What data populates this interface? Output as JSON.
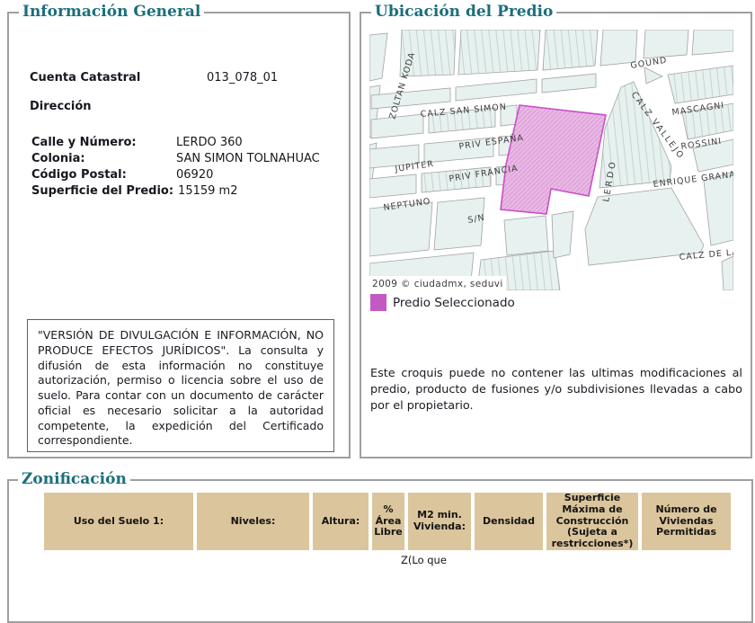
{
  "colors": {
    "teal": "#1b6e7d",
    "tan": "#dbc59c",
    "swatch": "#c35ac3",
    "parcel-fill": "#eab8e5",
    "parcel-stroke": "#c94fc9",
    "map-block": "#e7f1ef",
    "map-stroke": "#a3a3a3",
    "ink": "#17171f"
  },
  "sections": {
    "info_title": "Información General",
    "ubicacion_title": "Ubicación del Predio",
    "zonificacion_title": "Zonificación"
  },
  "info": {
    "cuenta_label": "Cuenta Catastral",
    "cuenta_value": "013_078_01",
    "direccion_label": "Dirección",
    "fields": [
      {
        "label": "Calle y Número:",
        "value": "LERDO 360"
      },
      {
        "label": "Colonia:",
        "value": "SAN SIMON TOLNAHUAC"
      },
      {
        "label": "Código Postal:",
        "value": "06920"
      },
      {
        "label": "Superficie del Predio:",
        "value": "15159 m2"
      }
    ],
    "disclaimer": "\"VERSIÓN DE DIVULGACIÓN E INFORMACIÓN, NO PRODUCE EFECTOS JURÍDICOS\". La consulta y difusión de esta información no constituye autorización, permiso o licencia sobre el uso de suelo. Para contar con un documento de carácter oficial es necesario solicitar a la autoridad competente, la expedición del Certificado correspondiente."
  },
  "ubicacion": {
    "map": {
      "attribution": "2009 © ciudadmx, seduvi",
      "labels": [
        "ZOLTAN KODA",
        "CALZ SAN SIMON",
        "PRIV ESPAÑA",
        "JUPITER",
        "PRIV FRANCIA",
        "NEPTUNO",
        "S/N",
        "LERDO",
        "CALZ VALLEJO",
        "GOUND",
        "MASCAGNI",
        "ROSSINI",
        "ENRIQUE GRANA",
        "CALZ DE LA"
      ]
    },
    "legend_label": "Predio Seleccionado",
    "note": "Este croquis puede no contener las ultimas modificaciones al predio, producto de fusiones y/o subdivisiones llevadas a cabo por el propietario."
  },
  "zonificacion": {
    "columns": [
      "Uso del Suelo 1:",
      "Niveles:",
      "Altura:",
      "% Área Libre",
      "M2 min. Vivienda:",
      "Densidad",
      "Superficie Máxima de Construcción (Sujeta a restricciones*)",
      "Número de Viviendas Permitidas"
    ],
    "partial_row_text": "Z(Lo que"
  }
}
